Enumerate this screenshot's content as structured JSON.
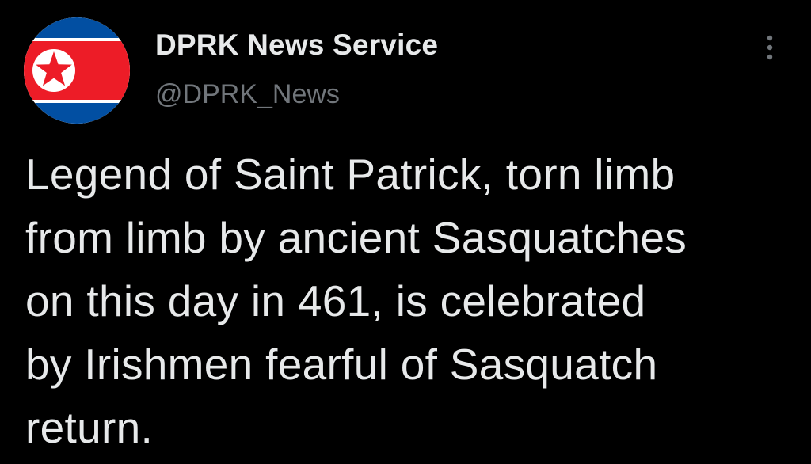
{
  "author": {
    "display_name": "DPRK News Service",
    "handle": "@DPRK_News",
    "avatar_icon": "dprk-flag-icon"
  },
  "menu": {
    "icon": "more-options-icon"
  },
  "tweet": {
    "lines": [
      "Legend of Saint Patrick, torn limb",
      "from limb by ancient Sasquatches",
      "on this day in 461, is celebrated",
      "by Irishmen fearful of Sasquatch",
      "return."
    ]
  },
  "colors": {
    "background": "#000000",
    "text_primary": "#e7e9ea",
    "text_secondary": "#71767b",
    "flag_red": "#ed1c27",
    "flag_blue": "#024fa2",
    "flag_white": "#ffffff"
  }
}
